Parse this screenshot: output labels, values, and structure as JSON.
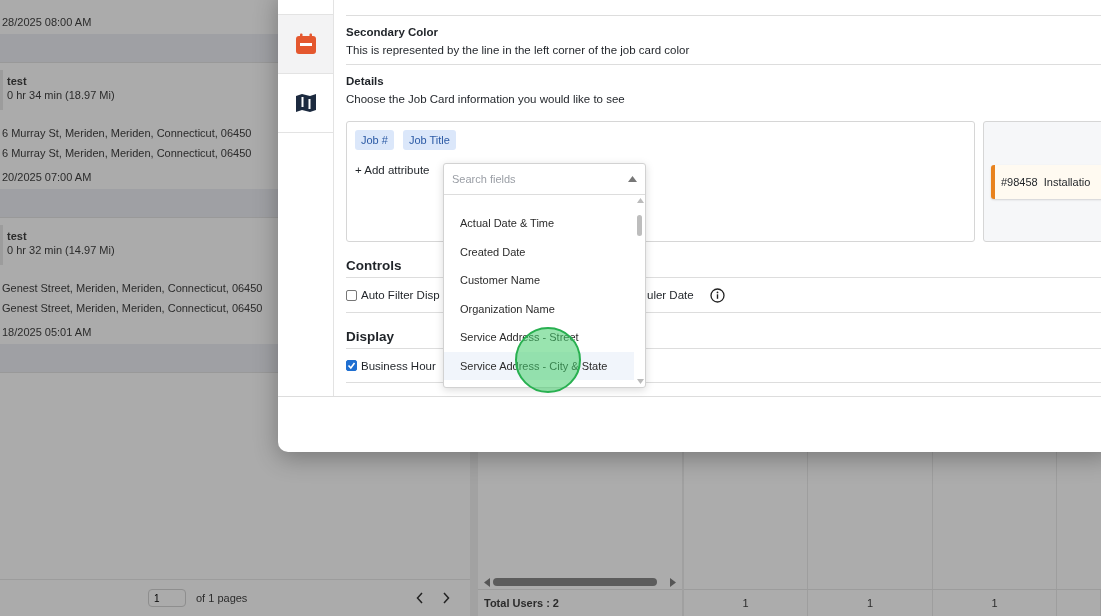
{
  "job_list": {
    "items": [
      {
        "date": "28/2025 08:00 AM"
      },
      {
        "title": "test",
        "duration": "0 hr 34 min (18.97 Mi)",
        "address_lines": [
          "6 Murray St, Meriden, Meriden, Connecticut, 06450",
          "6 Murray St, Meriden, Meriden, Connecticut, 06450"
        ],
        "date": "20/2025 07:00 AM"
      },
      {
        "title": "test",
        "duration": "0 hr 32 min (14.97 Mi)",
        "address_lines": [
          "Genest Street, Meriden, Meriden, Connecticut, 06450",
          "Genest Street, Meriden, Meriden, Connecticut, 06450"
        ],
        "date": "18/2025 05:01 AM"
      }
    ],
    "pager": {
      "page": "1",
      "label": "of 1 pages"
    }
  },
  "grid": {
    "total_label": "Total Users : 2",
    "footer_cells": [
      "1",
      "1",
      "1",
      ""
    ]
  },
  "modal": {
    "rail": [
      {
        "kind": "calendar",
        "selected": true
      },
      {
        "kind": "map",
        "selected": false
      }
    ],
    "secondary_color": {
      "title": "Secondary Color",
      "description": "This is represented by the line in the left corner of the job card color"
    },
    "details": {
      "title": "Details",
      "description": "Choose the Job Card information you would like to see",
      "chips": [
        "Job #",
        "Job Title"
      ],
      "add_label": "+ Add attribute",
      "preview_card": "#98458  Installatio"
    },
    "controls": {
      "title": "Controls",
      "checkbox": {
        "checked": false,
        "label_left": "Auto Filter Disp",
        "label_right": "uler Date"
      }
    },
    "display": {
      "title": "Display",
      "items": [
        {
          "label": "Business Hour",
          "checked": true
        }
      ]
    },
    "dropdown": {
      "placeholder": "Search fields",
      "options": [
        {
          "label": "Actual Date & Time",
          "selected": false
        },
        {
          "label": "Created Date",
          "selected": false
        },
        {
          "label": "Customer Name",
          "selected": false
        },
        {
          "label": "Organization Name",
          "selected": false
        },
        {
          "label": "Service Address - Street",
          "selected": false
        },
        {
          "label": "Service Address - City & State",
          "selected": true
        }
      ]
    }
  }
}
